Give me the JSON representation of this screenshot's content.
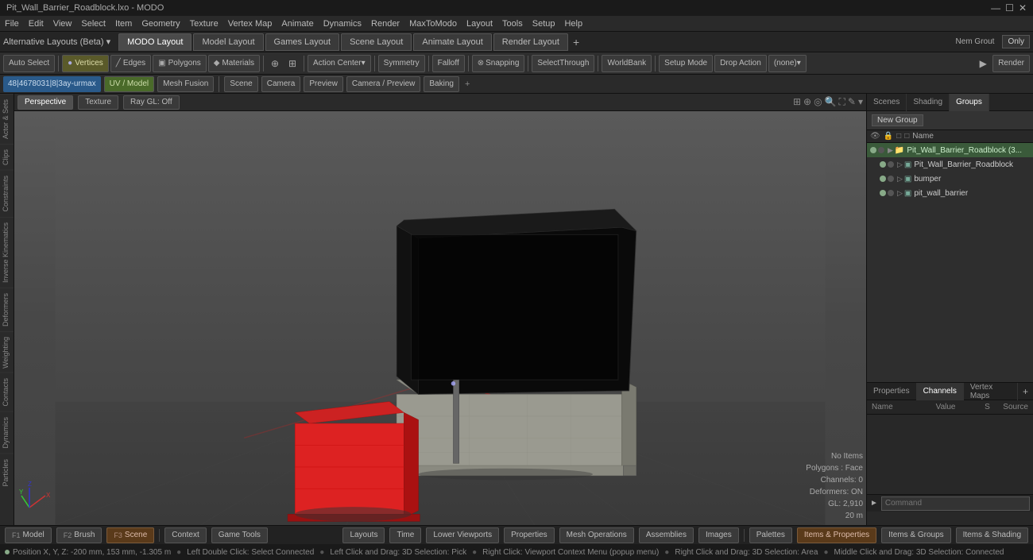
{
  "titlebar": {
    "title": "Pit_Wall_Barrier_Roadblock.lxo - MODO",
    "controls": [
      "—",
      "☐",
      "✕"
    ]
  },
  "menubar": {
    "items": [
      "File",
      "Edit",
      "View",
      "Select",
      "Item",
      "Geometry",
      "Texture",
      "Vertex Map",
      "Animate",
      "Dynamics",
      "Render",
      "MaxToModo",
      "Layout",
      "Tools",
      "Setup",
      "Help"
    ]
  },
  "alternative_layouts": {
    "label": "Alternative Layouts (Beta)",
    "arrow": "▾"
  },
  "layout_tabs": {
    "tabs": [
      {
        "label": "MODO Layout",
        "active": true
      },
      {
        "label": "Model Layout",
        "active": false
      },
      {
        "label": "Games Layout",
        "active": false
      },
      {
        "label": "Scene Layout",
        "active": false
      },
      {
        "label": "Animate Layout",
        "active": false
      },
      {
        "label": "Render Layout",
        "active": false
      }
    ],
    "add_btn": "+",
    "only_btn": "Only"
  },
  "toolbar": {
    "auto_select": "Auto Select",
    "vertices": "Vertices",
    "edges": "Edges",
    "polygons": "Polygons",
    "materials": "Materials",
    "action_center": "Action Center",
    "symmetry": "Symmetry",
    "falloff": "Falloff",
    "snapping": "Snapping",
    "select_through": "SelectThrough",
    "world_bank": "WorldBank",
    "setup_mode": "Setup Mode",
    "drop_action": "Drop Action",
    "none": "(none)",
    "render": "Render"
  },
  "viewport": {
    "breadcrumb": "48|4678031|8|3ay-urmax",
    "sub_tabs": [
      "UV / Model",
      "Mesh Fusion"
    ],
    "scene_label": "Scene",
    "camera_label": "Camera",
    "preview_label": "Preview",
    "camera_preview": "Camera / Preview",
    "baking": "Baking",
    "perspective_tab": "Perspective",
    "texture_tab": "Texture",
    "raygl_tab": "Ray GL: Off",
    "hud": {
      "no_items": "No Items",
      "polygons": "Polygons : Face",
      "channels": "Channels: 0",
      "deformers": "Deformers: ON",
      "gl": "GL: 2,910",
      "distance": "20 m"
    }
  },
  "right_panel": {
    "tabs": [
      "Scenes",
      "Shading",
      "Groups"
    ],
    "active_tab": "Groups",
    "new_group_btn": "New Group",
    "tree": {
      "root": {
        "name": "Pit_Wall_Barrier_Roadblock (3...",
        "children": [
          {
            "name": "Pit_Wall_Barrier_Roadblock",
            "children": []
          },
          {
            "name": "bumper",
            "children": []
          },
          {
            "name": "pit_wall_barrier",
            "children": []
          }
        ]
      }
    }
  },
  "bottom_panel": {
    "tabs": [
      "Properties",
      "Channels",
      "Vertex Maps"
    ],
    "active_tab": "Channels",
    "plus": "+",
    "cols": [
      "Name",
      "Value",
      "S",
      "Source"
    ]
  },
  "bottom_bar": {
    "items": [
      {
        "label": "Model",
        "key": "F1",
        "active": false
      },
      {
        "label": "Brush",
        "key": "F2",
        "active": false
      },
      {
        "label": "Scene",
        "key": "F3",
        "active": true
      },
      {
        "label": "Context",
        "key": "",
        "active": false
      },
      {
        "label": "Game Tools",
        "key": "",
        "active": false
      }
    ],
    "right_items": [
      {
        "label": "Layouts"
      },
      {
        "label": "Time"
      },
      {
        "label": "Lower Viewports"
      },
      {
        "label": "Properties"
      },
      {
        "label": "Mesh Operations"
      },
      {
        "label": "Assemblies"
      },
      {
        "label": "Images"
      }
    ],
    "far_right": [
      {
        "label": "Palettes"
      },
      {
        "label": "Items & Properties",
        "active": true
      },
      {
        "label": "Items & Groups"
      },
      {
        "label": "Items & Shading"
      }
    ]
  },
  "status_bar": {
    "position": "Position X, Y, Z:  -200 mm, 153 mm, -1.305 m",
    "help1": "Left Double Click: Select Connected",
    "help2": "Left Click and Drag: 3D Selection: Pick",
    "help3": "Right Click: Viewport Context Menu (popup menu)",
    "help4": "Right Click and Drag: 3D Selection: Area",
    "help5": "Middle Click and Drag: 3D Selection: Connected"
  },
  "left_panels": {
    "tabs": [
      "Actor & Sets",
      "Clips",
      "Constraints",
      "Inverse Kinematics",
      "Deformers",
      "Weighting",
      "Contacts",
      "Dynamics",
      "Particles"
    ]
  },
  "command": {
    "label": "►",
    "placeholder": "Command"
  },
  "user": {
    "name": "Nem Grout"
  }
}
